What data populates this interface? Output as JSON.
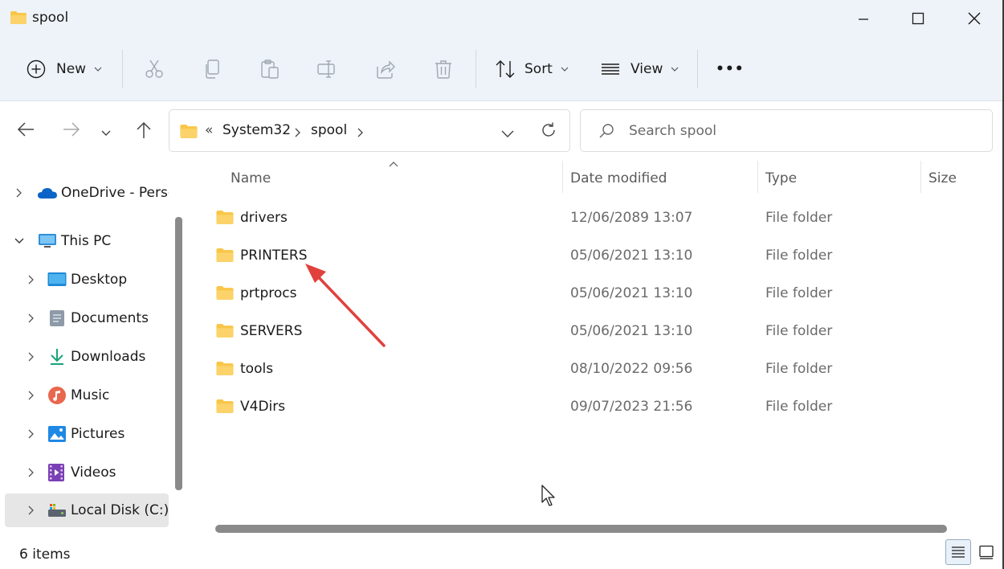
{
  "window": {
    "title": "spool"
  },
  "commandbar": {
    "new_label": "New",
    "sort_label": "Sort",
    "view_label": "View",
    "more_label": "•••"
  },
  "navigation": {
    "breadcrumb_overflow": "«",
    "path": [
      "System32",
      "spool"
    ],
    "search_placeholder": "Search spool"
  },
  "sidebar": {
    "items": [
      {
        "label": "OneDrive - Personal",
        "icon": "onedrive-cloud-icon"
      },
      {
        "label": "This PC",
        "icon": "this-pc-icon"
      },
      {
        "label": "Desktop",
        "icon": "desktop-icon"
      },
      {
        "label": "Documents",
        "icon": "documents-icon"
      },
      {
        "label": "Downloads",
        "icon": "downloads-icon"
      },
      {
        "label": "Music",
        "icon": "music-icon"
      },
      {
        "label": "Pictures",
        "icon": "pictures-icon"
      },
      {
        "label": "Videos",
        "icon": "videos-icon"
      },
      {
        "label": "Local Disk (C:)",
        "icon": "local-disk-icon"
      }
    ]
  },
  "columns": {
    "name": "Name",
    "date_modified": "Date modified",
    "type": "Type",
    "size": "Size"
  },
  "files": [
    {
      "name": "drivers",
      "date": "12/06/2089 13:07",
      "type": "File folder"
    },
    {
      "name": "PRINTERS",
      "date": "05/06/2021 13:10",
      "type": "File folder"
    },
    {
      "name": "prtprocs",
      "date": "05/06/2021 13:10",
      "type": "File folder"
    },
    {
      "name": "SERVERS",
      "date": "05/06/2021 13:10",
      "type": "File folder"
    },
    {
      "name": "tools",
      "date": "08/10/2022 09:56",
      "type": "File folder"
    },
    {
      "name": "V4Dirs",
      "date": "09/07/2023 21:56",
      "type": "File folder"
    }
  ],
  "status": {
    "item_count": "6 items"
  },
  "colors": {
    "chrome_bg": "#eef3f9",
    "folder_yellow": "#f8c648",
    "annotation_arrow": "#e0413d",
    "accent_blue": "#0a64c8"
  }
}
